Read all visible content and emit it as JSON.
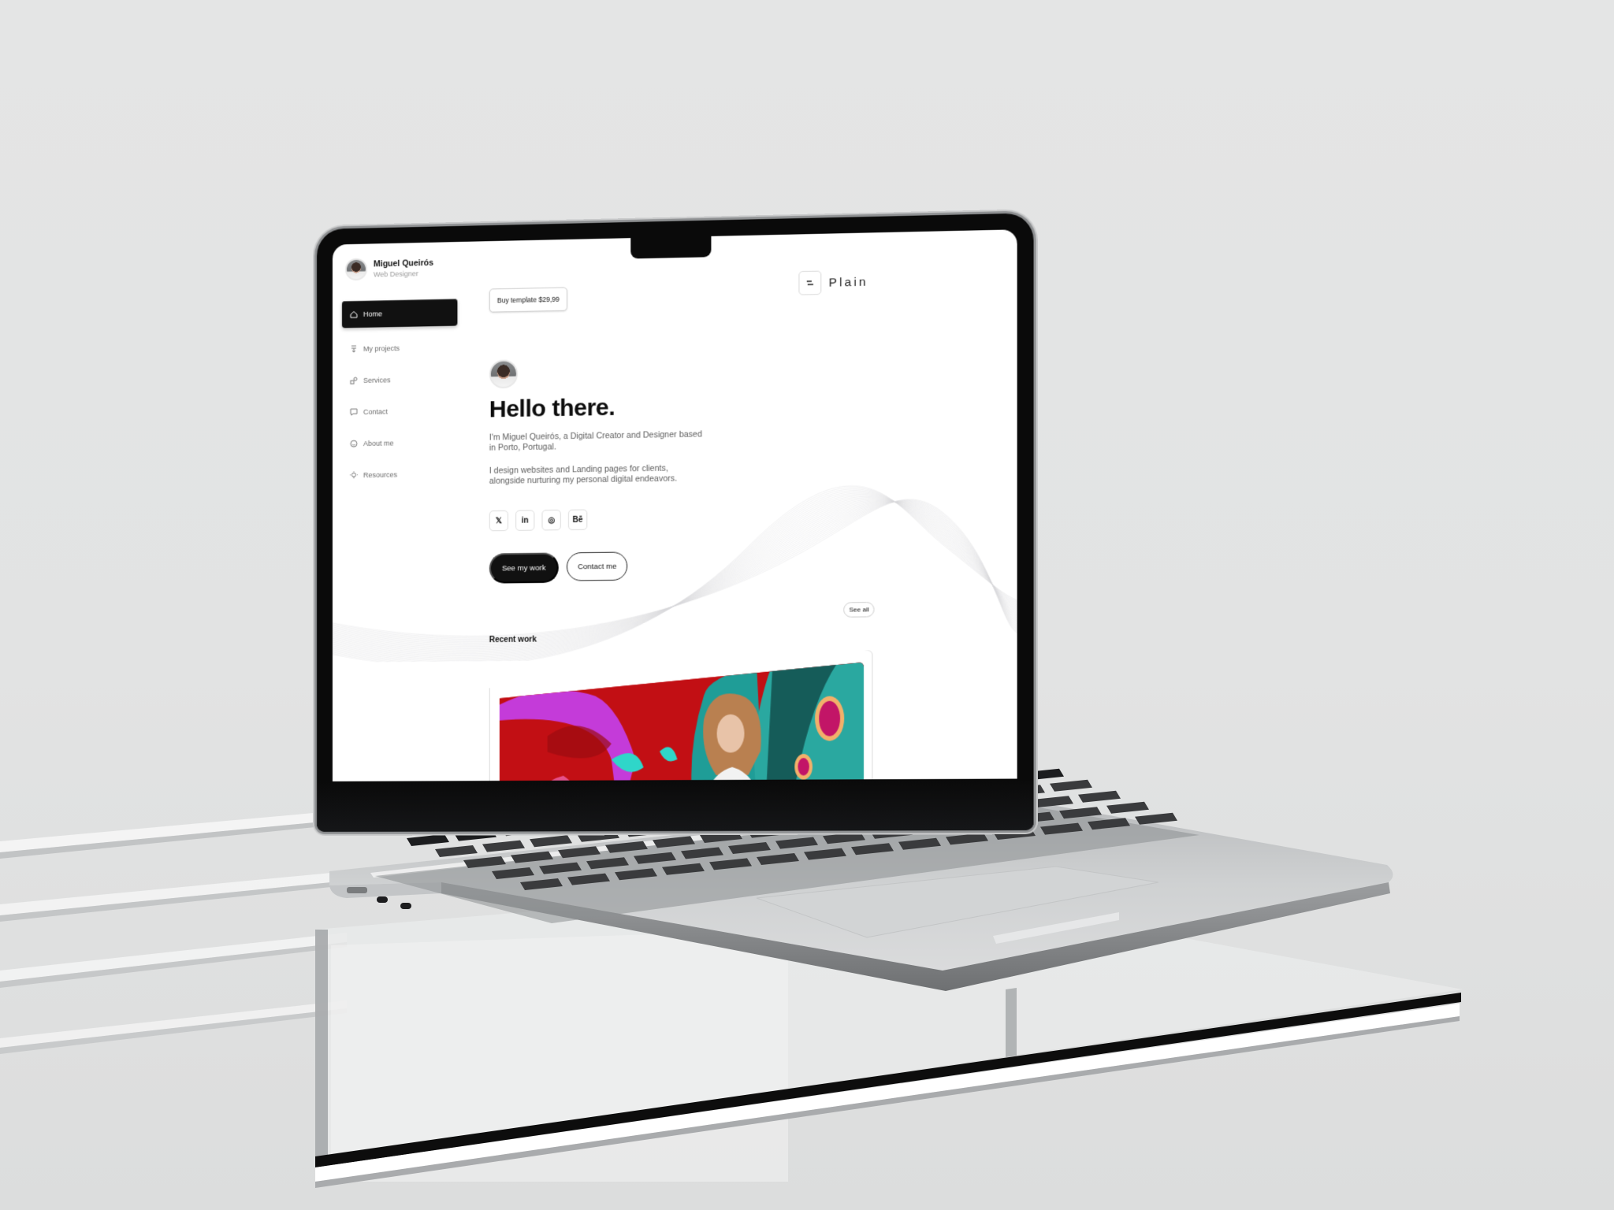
{
  "scene": {
    "description": "MacBook mockup on glass shelf showing portfolio website",
    "colors": {
      "background": "#e3e4e4",
      "laptop_silver": "#c9cbcc",
      "bezel": "#0a0a0a",
      "accent_dark": "#111111"
    }
  },
  "site": {
    "profile": {
      "name": "Miguel Queirós",
      "role": "Web Designer"
    },
    "nav": [
      {
        "label": "Home",
        "icon": "home-icon",
        "active": true
      },
      {
        "label": "My projects",
        "icon": "projects-icon",
        "active": false
      },
      {
        "label": "Services",
        "icon": "services-icon",
        "active": false
      },
      {
        "label": "Contact",
        "icon": "chat-icon",
        "active": false
      },
      {
        "label": "About me",
        "icon": "smile-icon",
        "active": false
      },
      {
        "label": "Resources",
        "icon": "lightbulb-icon",
        "active": false
      }
    ],
    "buy_button": "Buy template $29,99",
    "logo": {
      "icon": "menu-lines-icon",
      "text": "Plain"
    },
    "hero": {
      "title": "Hello there.",
      "paragraph_1": "I'm Miguel Queirós, a Digital Creator and Designer based in Porto, Portugal.",
      "paragraph_2": "I design websites and Landing pages for clients, alongside nurturing my personal digital endeavors."
    },
    "socials": [
      {
        "name": "x",
        "glyph": "𝕏"
      },
      {
        "name": "linkedin",
        "glyph": "in"
      },
      {
        "name": "dribbble",
        "glyph": "◎"
      },
      {
        "name": "behance",
        "glyph": "Bē"
      }
    ],
    "cta": {
      "primary": "See my work",
      "secondary": "Contact me"
    },
    "recent_work": {
      "label": "Recent work",
      "see_all": "See all",
      "image_alt": "Colorful illustration with a woman, red background, teal leaves and butterfly wing"
    }
  }
}
